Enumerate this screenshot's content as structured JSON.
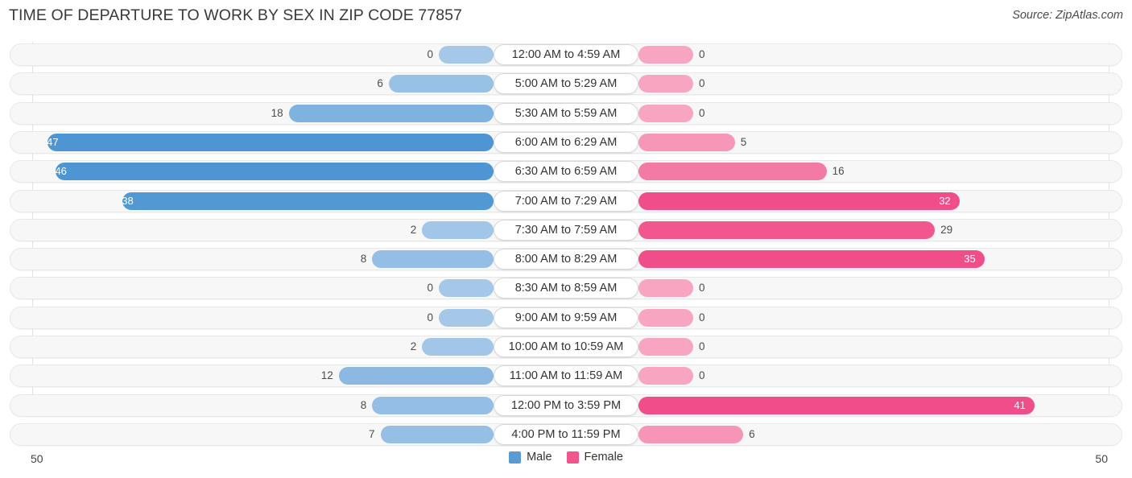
{
  "header": {
    "title": "TIME OF DEPARTURE TO WORK BY SEX IN ZIP CODE 77857",
    "source": "Source: ZipAtlas.com"
  },
  "axis": {
    "left_max": "50",
    "right_max": "50"
  },
  "legend": {
    "items": [
      {
        "label": "Male",
        "color": "#5B9BD5"
      },
      {
        "label": "Female",
        "color": "#F2558C"
      }
    ]
  },
  "chart_data": {
    "type": "bar",
    "title": "TIME OF DEPARTURE TO WORK BY SEX IN ZIP CODE 77857",
    "subtitle": "Source: ZipAtlas.com",
    "orientation": "horizontal-diverging",
    "xlabel": "",
    "ylabel": "",
    "xlim": [
      50,
      50
    ],
    "grid": true,
    "legend_position": "bottom-center",
    "categories": [
      "12:00 AM to 4:59 AM",
      "5:00 AM to 5:29 AM",
      "5:30 AM to 5:59 AM",
      "6:00 AM to 6:29 AM",
      "6:30 AM to 6:59 AM",
      "7:00 AM to 7:29 AM",
      "7:30 AM to 7:59 AM",
      "8:00 AM to 8:29 AM",
      "8:30 AM to 8:59 AM",
      "9:00 AM to 9:59 AM",
      "10:00 AM to 10:59 AM",
      "11:00 AM to 11:59 AM",
      "12:00 PM to 3:59 PM",
      "4:00 PM to 11:59 PM"
    ],
    "series": [
      {
        "name": "Male",
        "values": [
          0,
          6,
          18,
          47,
          46,
          38,
          2,
          8,
          0,
          0,
          2,
          12,
          8,
          7
        ]
      },
      {
        "name": "Female",
        "values": [
          0,
          0,
          0,
          5,
          16,
          32,
          29,
          35,
          0,
          0,
          0,
          0,
          41,
          6
        ]
      }
    ]
  }
}
